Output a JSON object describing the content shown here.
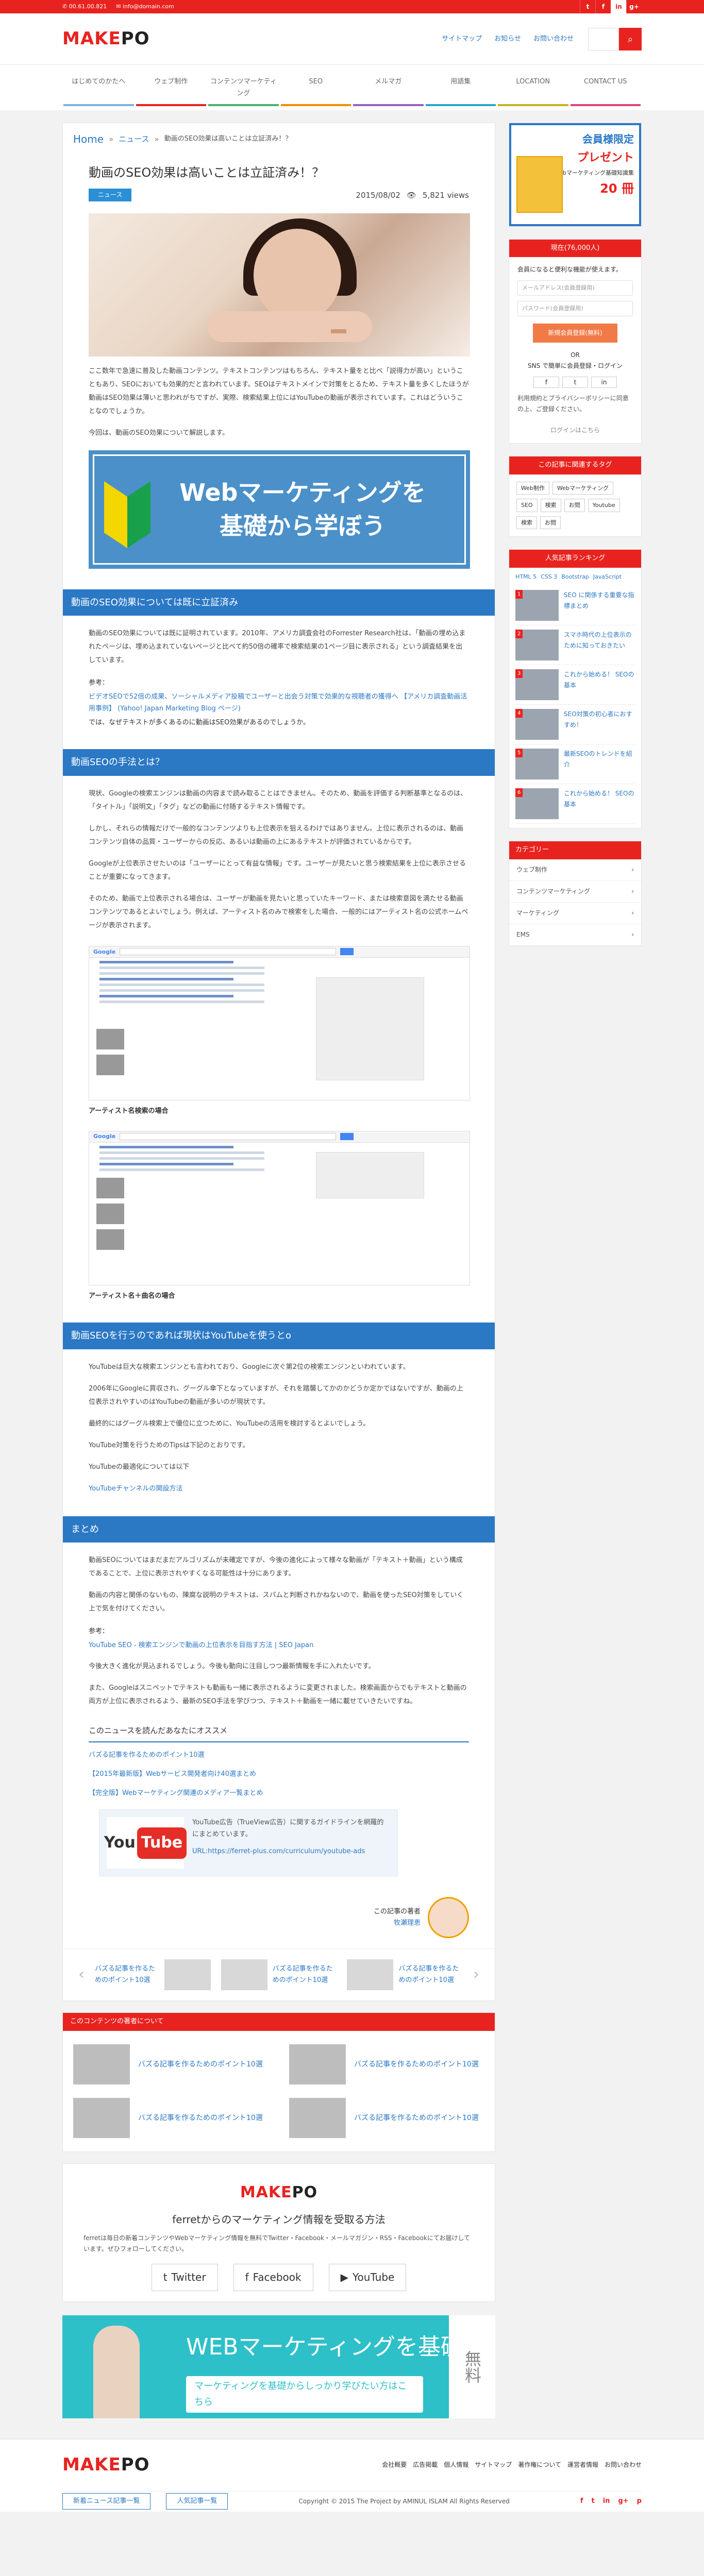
{
  "topbar": {
    "phone": "✆ 00.61.00.821",
    "email": "✉ info@domain.com",
    "social": [
      "t",
      "f",
      "in",
      "g+"
    ]
  },
  "header": {
    "logo_m": "MAKE",
    "logo_po": "PO",
    "links": [
      "サイトマップ",
      "お知らせ",
      "お問い合わせ"
    ],
    "search_placeholder": ""
  },
  "nav": [
    "はじめてのかたへ",
    "ウェブ制作",
    "コンテンツマーケティング",
    "SEO",
    "メルマガ",
    "用語集",
    "LOCATION",
    "CONTACT US"
  ],
  "breadcrumb": {
    "home": "Home",
    "news": "ニュース",
    "current": "動画のSEO効果は高いことは立証済み！？"
  },
  "article": {
    "title": "動画のSEO効果は高いことは立証済み！？",
    "category": "ニュース",
    "date": "2015/08/02",
    "views": "5,821 views",
    "intro": "ここ数年で急速に普及した動画コンテンツ。テキストコンテンツはもちろん、テキスト量をと比べ「説得力が高い」ということもあり、SEOにおいても効果的だと言われています。SEOはテキストメインで対策をとるため、テキスト量を多くしたほうが動画はSEO効果は薄いと思われがちですが、実際、検索結果上位にはYouTubeの動画が表示されています。これはどういうことなのでしょうか。",
    "intro2": "今回は、動画のSEO効果について解説します。",
    "banner_text_1": "Webマーケティングを",
    "banner_text_2": "基礎から学ぼう",
    "h2_1": "動画のSEO効果については既に立証済み",
    "p1": "動画のSEO効果については既に証明されています。2010年、アメリカ調査会社のForrester Research社は、「動画の埋め込まれたページは、埋め込まれていないページと比べて約50倍の確率で検索結果の1ページ目に表示される」という調査結果を出しています。",
    "source_label": "参考：",
    "source_link": "ビデオSEOで52倍の成果、ソーシャルメディア投稿でユーザーと出会う対策で効果的な視聴者の獲得へ 【アメリカ調査動画活用事例】 (Yahoo! Japan Marketing Blog ページ)",
    "p1b": "では、なぜテキストが多くあるのに動画はSEO効果があるのでしょうか。",
    "h2_2": "動画SEOの手法とは？",
    "p2": "現状、Googleの検索エンジンは動画の内容まで読み取ることはできません。そのため、動画を評価する判断基準となるのは、「タイトル」「説明文」「タグ」などの動画に付随するテキスト情報です。",
    "p3": "しかし、それらの情報だけで一般的なコンテンツよりも上位表示を狙えるわけではありません。上位に表示されるのは、動画コンテンツ自体の品質・ユーザーからの反応、あるいは動画の上にあるテキストが評価されているからです。",
    "p4": "Googleが上位表示させたいのは「ユーザーにとって有益な情報」です。ユーザーが見たいと思う検索結果を上位に表示させることが重要になってきます。",
    "p5": "そのため、動画で上位表示される場合は、ユーザーが動画を見たいと思っていたキーワード、または検索意図を満たせる動画コンテンツであるとよいでしょう。例えば、アーティスト名のみで検索をした場合、一般的にはアーティスト名の公式ホームページが表示されます。",
    "caption_1": "アーティスト名検索の場合",
    "caption_2": "アーティスト名＋曲名の場合",
    "h2_3": "動画SEOを行うのであれば現状はYouTubeを使うとo",
    "p6": "YouTubeは巨大な検索エンジンとも言われており、Googleに次ぐ第2位の検索エンジンといわれています。",
    "p7": "2006年にGoogleに買収され、グーグル傘下となっていますが、それを踏襲してかのかどうか定かではないですが、動画の上位表示されやすいのはYouTubeの動画が多いのが現状です。",
    "p8": "最終的にはグーグル検索上で優位に立つために、YouTubeの活用を検討するとよいでしょう。",
    "p9": "YouTube対策を行うためのTipsは下記のとおりです。",
    "p10": "YouTubeの最適化については以下",
    "p11": "YouTubeチャンネルの開設方法",
    "h2_4": "まとめ",
    "p12": "動画SEOについてはまだまだアルゴリズムが未確定ですが、今後の進化によって様々な動画が「テキスト＋動画」という構成であることで、上位に表示されやすくなる可能性は十分にあります。",
    "p13": "動画の内容と関係のないもの、陳腐な説明のテキストは、スパムと判断されかねないので、動画を使ったSEO対策をしていく上で気を付けてください。",
    "source_label_2": "参考：",
    "source_link_2": "YouTube SEO - 検索エンジンで動画の上位表示を目指す方法 | SEO Japan",
    "p14": "今後大きく進化が見込まれるでしょう。今後も動向に注目しつつ最新情報を手に入れたいです。",
    "p15": "また、Googleはスニペットでテキストも動画も一緒に表示されるように変更されました。検索画面からでもテキストと動画の両方が上位に表示されるよう、最新のSEO手法を学びつつ、テキスト＋動画を一緒に載せていきたいですね。",
    "recommend_head": "このニュースを読んだあなたにオススメ",
    "recommend_1": "バズる記事を作るためのポイント10選",
    "recommend_2": "【2015年最新版】Webサービス開発者向け40選まとめ",
    "recommend_3": "【完全版】Webマーケティング関連のメディア一覧まとめ",
    "yt_logo_you": "You",
    "yt_logo_tube": "Tube",
    "yt_desc": "YouTube広告（TrueView広告）に関するガイドラインを網羅的にまとめています。",
    "yt_url": "URL:https://ferret-plus.com/curriculum/youtube-ads",
    "author_label": "この記事の著者",
    "author_name": "牧瀬理恵",
    "prev_title": "バズる記事を作るためのポイント10選",
    "next_title_1": "バズる記事を作るためのポイント10選",
    "next_title_2": "バズる記事を作るためのポイント10選"
  },
  "related": {
    "head": "このコンテンツの著者について",
    "items": [
      "バズる記事を作るためのポイント10選",
      "バズる記事を作るためのポイント10選",
      "バズる記事を作るためのポイント10選",
      "バズる記事を作るためのポイント10選"
    ]
  },
  "ferret": {
    "title": "ferretからのマーケティング情報を受取る方法",
    "desc": "ferretは毎日の新着コンテンツやWebマーケティング情報を無料でTwitter・Facebook・メールマガジン・RSS・Facebookにてお届けしています。ぜひフォローしてください。",
    "btn_twitter": "Twitter",
    "btn_facebook": "Facebook",
    "btn_youtube": "YouTube"
  },
  "cta": {
    "title": "WEBマーケティングを基礎から",
    "sub": "マーケティングを基礎からしっかり学びたい方はこちら",
    "free": "無料"
  },
  "sidebar": {
    "ad_1": "会員様限定",
    "ad_2": "プレゼント",
    "ad_3": "Webマーケティング基礎知識集",
    "ad_4": "20 冊",
    "login_head": "現在(76,000人)",
    "login_desc": "会員になると便利な機能が使えます。",
    "email_placeholder": "メールアドレス(会員登録用)",
    "password_placeholder": "パスワード(会員登録用)",
    "register_btn": "新規会員登録(無料)",
    "or": "OR",
    "sns_label": "SNS で簡単に会員登録・ログイン",
    "sns": [
      "f",
      "t",
      "in"
    ],
    "terms": "利用規約とプライバシーポリシーに同意の上、ご登録ください。",
    "logout": "ログインはこちら",
    "tags_head": "この記事に関連するタグ",
    "tags": [
      "Web制作",
      "Webマーケティング",
      "SEO",
      "検索",
      "お問",
      "Youtube",
      "検索",
      "お問"
    ],
    "rank_head": "人気記事ランキング",
    "rank_tabs": [
      "HTML 5",
      "CSS 3",
      "Bootstrap",
      "JavaScript"
    ],
    "rank_items": [
      "SEO に関係する重要な指標まとめ",
      "スマホ時代の上位表示のために知っておきたい",
      "これから始める！ SEOの基本",
      "SEO対策の初心者におすすめ！",
      "最新SEOのトレンドを紹介",
      "これから始める！ SEOの基本"
    ],
    "cat_head": "カテゴリー",
    "cats": [
      "ウェブ制作",
      "コンテンツマーケティング",
      "マーケティング",
      "EMS"
    ]
  },
  "footer": {
    "links": [
      "会社概要",
      "広告掲載",
      "個人情報",
      "サイトマップ",
      "著作権について",
      "運営者情報",
      "お問い合わせ"
    ],
    "btn_1": "新着ニュース記事一覧",
    "btn_2": "人気記事一覧",
    "copy": "Copyright © 2015 The Project by AMINUL ISLAM All Rights Reserved",
    "social": [
      "f",
      "t",
      "in",
      "g+",
      "p"
    ]
  }
}
